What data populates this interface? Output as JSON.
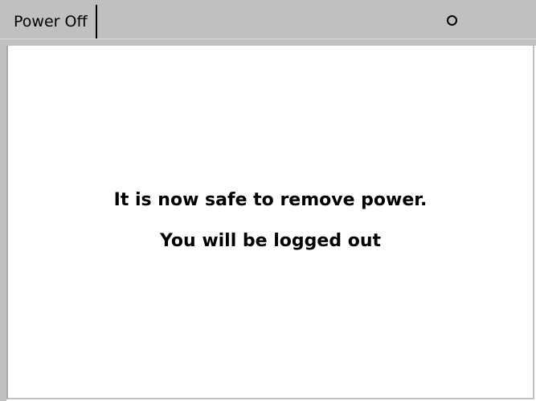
{
  "window": {
    "tab_label": "Power Off",
    "status_icon": "circle-icon"
  },
  "message": {
    "line1": "It is now safe to remove power.",
    "line2": "You will be logged out"
  },
  "colors": {
    "chrome": "#c0c0c0",
    "background": "#ffffff",
    "text": "#000000"
  }
}
